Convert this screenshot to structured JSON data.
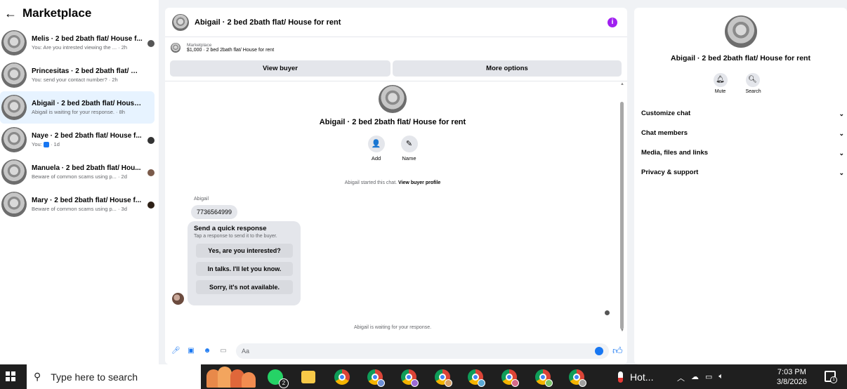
{
  "sidebar": {
    "title": "Marketplace",
    "back_icon": "←",
    "conversations": [
      {
        "name": "Melis · 2 bed 2bath flat/ House f...",
        "preview": "You: Are you intrested viewing the ... · 2h"
      },
      {
        "name": "Princesitas · 2 bed 2bath flat/ Hou...",
        "preview": "You: send your contact number? · 2h"
      },
      {
        "name": "Abigail · 2 bed 2bath flat/ House f...",
        "preview": "Abigail is waiting for your response. · 8h"
      },
      {
        "name": "Naye · 2 bed 2bath flat/ House f...",
        "preview_prefix": "You:",
        "preview_suffix": "· 1d"
      },
      {
        "name": "Manuela · 2 bed 2bath flat/ Hou...",
        "preview": "Beware of common scams using p... · 2d"
      },
      {
        "name": "Mary · 2 bed 2bath flat/ House f...",
        "preview": "Beware of common scams using p... · 3d"
      }
    ]
  },
  "chat": {
    "header_title": "Abigail · 2 bed 2bath flat/ House for rent",
    "marketplace_label": "Marketplace",
    "listing": "$1,000 · 2 bed 2bath flat/ House for rent",
    "view_buyer": "View buyer",
    "more_options": "More options",
    "profile_name": "Abigail · 2 bed 2bath flat/ House for rent",
    "add_label": "Add",
    "name_label": "Name",
    "started_text": "Abigail started this chat.",
    "view_profile": "View buyer profile",
    "sender": "Abigail",
    "message": "7736564999",
    "quick_title": "Send a quick response",
    "quick_sub": "Tap a response to send it to the buyer.",
    "quick_options": [
      "Yes, are you interested?",
      "In talks. I'll let you know.",
      "Sorry, it's not available."
    ],
    "waiting": "Abigail is waiting for your response.",
    "composer_placeholder": "Aa"
  },
  "right_panel": {
    "name": "Abigail · 2 bed 2bath flat/ House for rent",
    "mute": "Mute",
    "search": "Search",
    "menu": [
      "Customize chat",
      "Chat members",
      "Media, files and links",
      "Privacy & support"
    ]
  },
  "taskbar": {
    "search_placeholder": "Type here to search",
    "whatsapp_badge": "2",
    "weather": "Hot...",
    "time": "7:03 PM",
    "date": "3/8/2026",
    "notification_count": "1"
  },
  "colors": {
    "accent": "#1877f2",
    "active_row": "#e7f3ff",
    "info": "#a020f0"
  }
}
